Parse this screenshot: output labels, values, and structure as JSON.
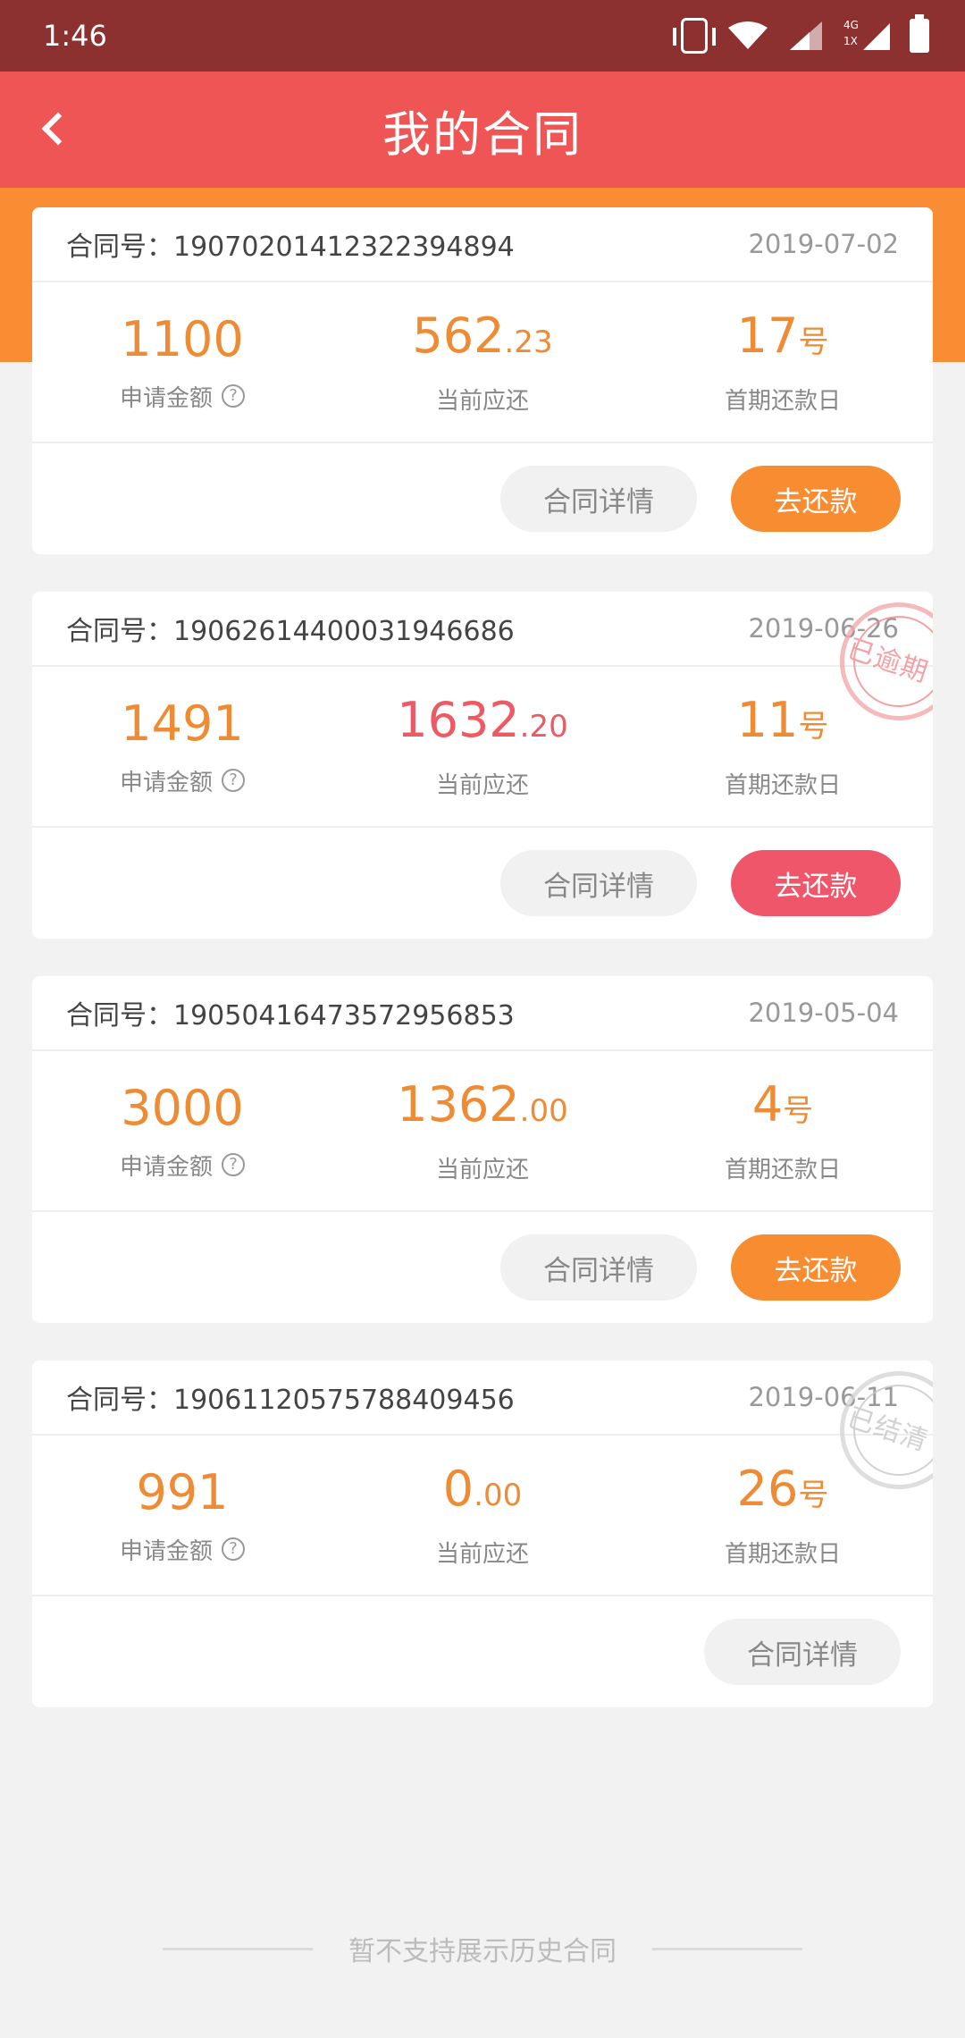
{
  "status_bar": {
    "time": "1:46",
    "network_badge_top": "4G",
    "network_badge_bottom": "1X"
  },
  "header": {
    "title": "我的合同"
  },
  "contract_label": "合同号：",
  "labels": {
    "amount": "申请金额",
    "current_due": "当前应还",
    "first_due_day": "首期还款日",
    "day_suffix": "号",
    "detail_button": "合同详情",
    "pay_button": "去还款",
    "help": "?"
  },
  "contracts": [
    {
      "number": "19070201412322394894",
      "date": "2019-07-02",
      "amount": "1100",
      "due_int": "562",
      "due_dec": ".23",
      "first_day": "17",
      "stamp": ""
    },
    {
      "number": "19062614400031946686",
      "date": "2019-06-26",
      "amount": "1491",
      "due_int": "1632",
      "due_dec": ".20",
      "first_day": "11",
      "stamp": "已逾期"
    },
    {
      "number": "19050416473572956853",
      "date": "2019-05-04",
      "amount": "3000",
      "due_int": "1362",
      "due_dec": ".00",
      "first_day": "4",
      "stamp": ""
    },
    {
      "number": "19061120575788409456",
      "date": "2019-06-11",
      "amount": "991",
      "due_int": "0",
      "due_dec": ".00",
      "first_day": "26",
      "stamp": "已结清"
    }
  ],
  "footer": {
    "note": "暂不支持展示历史合同"
  },
  "colors": {
    "status_bar": "#8c3030",
    "header": "#f05556",
    "band": "#fa8c33",
    "accent_orange": "#ee8b35",
    "accent_red": "#ec5a64"
  }
}
